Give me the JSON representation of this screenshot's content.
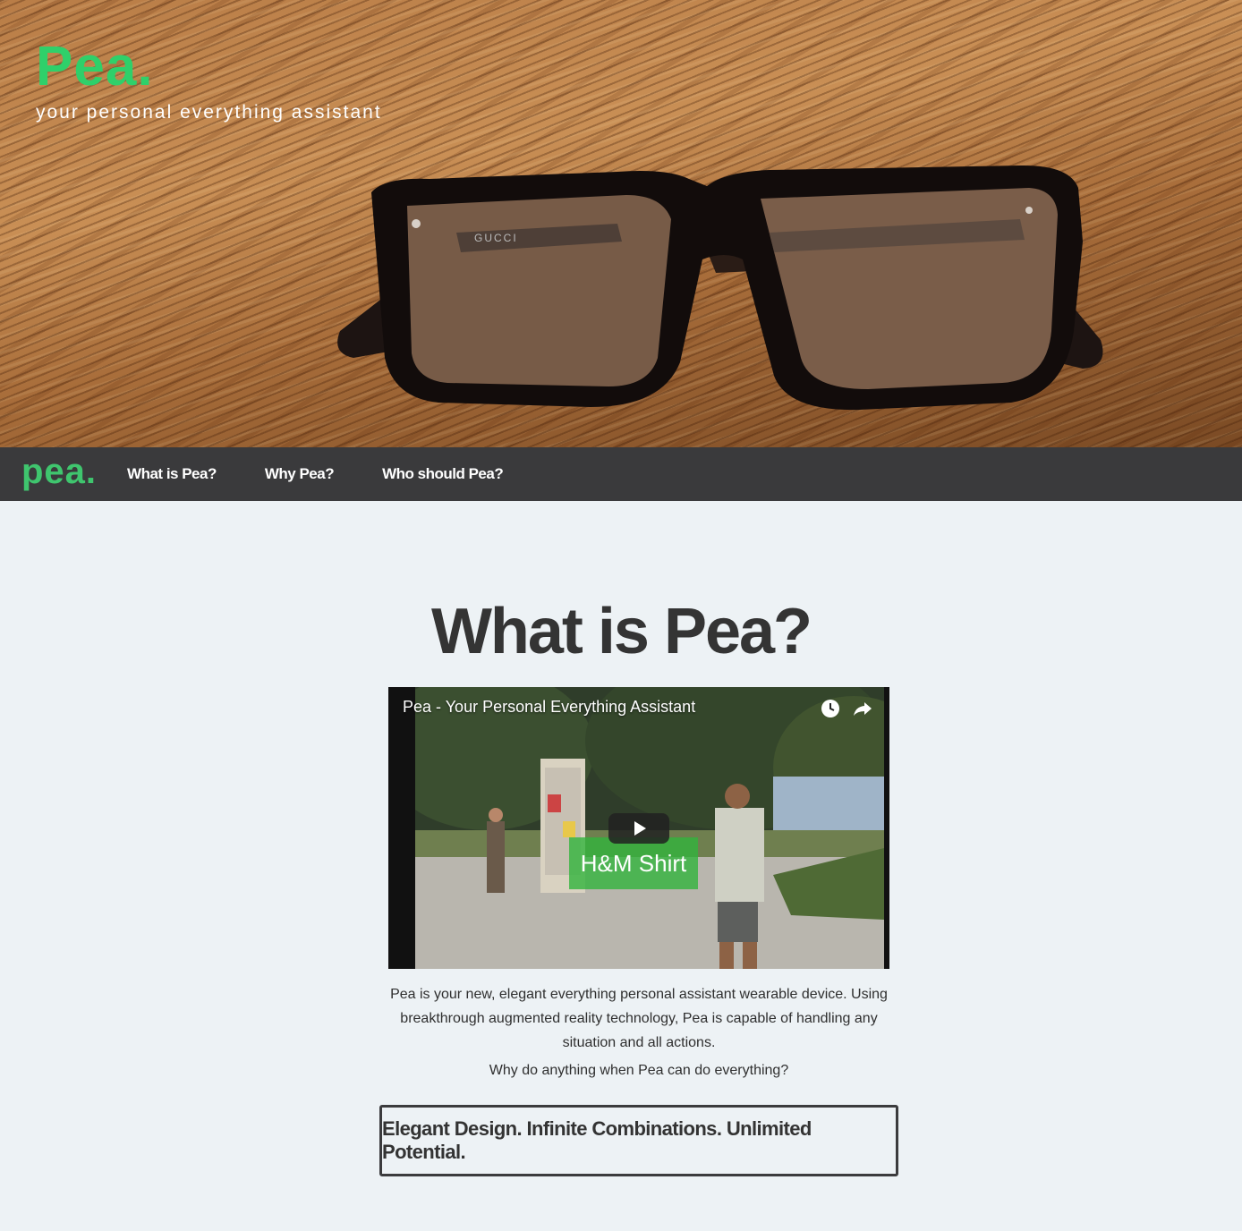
{
  "hero": {
    "brand": "Pea.",
    "tagline": "your personal everything assistant"
  },
  "nav": {
    "logo": "pea.",
    "items": [
      {
        "label": "What is Pea?"
      },
      {
        "label": "Why Pea?"
      },
      {
        "label": "Who should Pea?"
      }
    ]
  },
  "main": {
    "title": "What is Pea?",
    "video": {
      "title": "Pea - Your Personal Everything Assistant",
      "overlay_text": "H&M Shirt",
      "icons": [
        "clock-icon",
        "share-icon",
        "play-icon"
      ]
    },
    "description": "Pea is your new, elegant everything personal assistant wearable device. Using breakthrough augmented reality technology, Pea is capable of handling any situation and all actions.",
    "question": "Why do anything when Pea can do everything?",
    "tagline_box": "Elegant Design. Infinite Combinations. Unlimited Potential."
  },
  "colors": {
    "brand_green": "#2fd06a",
    "nav_bg": "#3a3a3c",
    "page_bg": "#edf2f5"
  }
}
